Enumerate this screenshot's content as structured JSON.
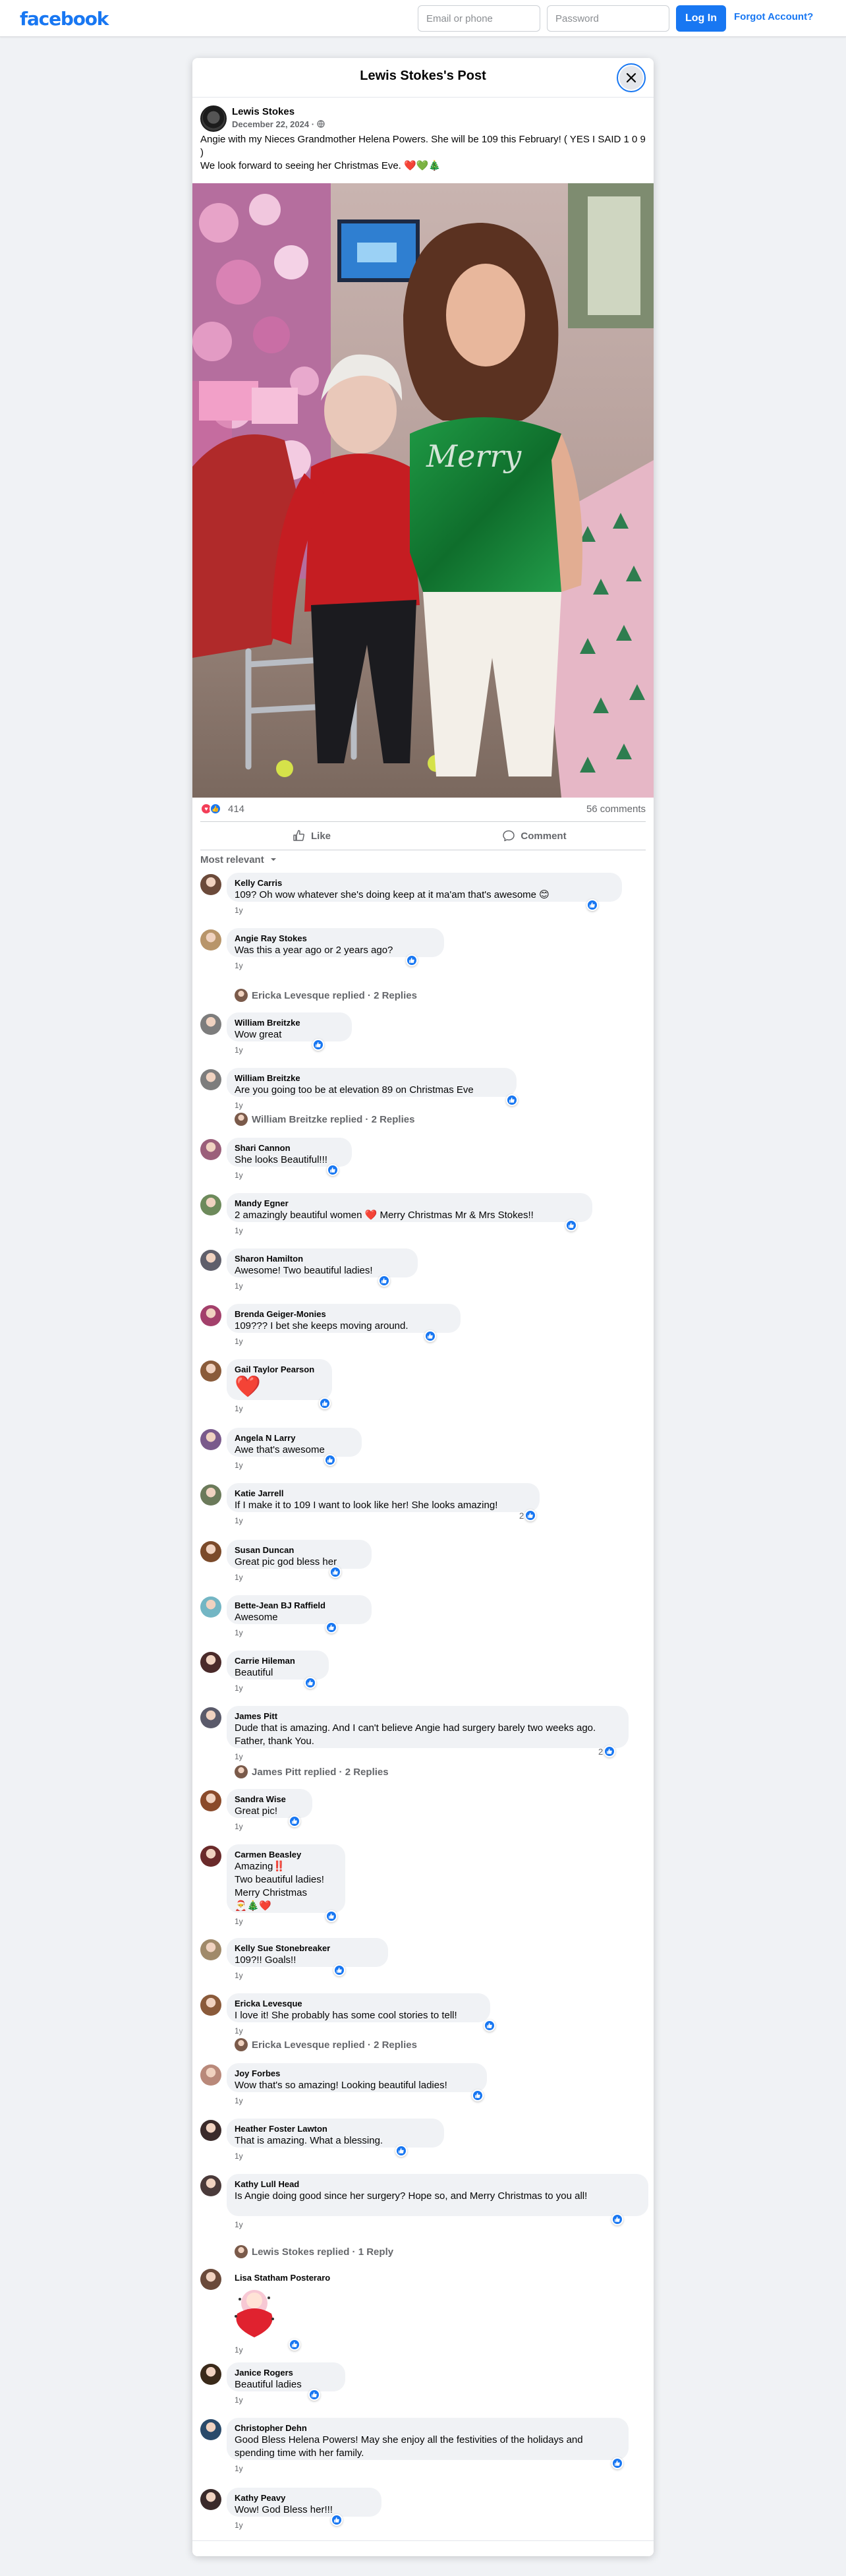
{
  "topbar": {
    "logo": "facebook",
    "email_placeholder": "Email or phone",
    "password_placeholder": "Password",
    "login_label": "Log In",
    "forgot_label": "Forgot Account?"
  },
  "post": {
    "header_title": "Lewis Stokes's Post",
    "author": "Lewis Stokes",
    "date": "December 22, 2024 · ",
    "privacy_icon": "globe-icon",
    "text_line1": "Angie with my Nieces Grandmother Helena Powers. She will be 109 this February! ( YES I SAID 1 0 9  )",
    "text_line2": "We look forward to seeing her Christmas Eve. ❤️💚🎄",
    "photo_shirt_text": "Merry",
    "reaction_count": "414",
    "comment_count": "56 comments",
    "like_label": "Like",
    "comment_label": "Comment",
    "sort_label": "Most relevant"
  },
  "comments": [
    {
      "name": "Kelly Carris",
      "text": "109? Oh wow whatever she's doing keep at it ma'am that's awesome 😊",
      "time": "1y",
      "likes": ""
    },
    {
      "name": "Angie Ray Stokes",
      "text": "Was this a year ago or 2 years ago?",
      "time": "1y",
      "likes": "",
      "replies": "Ericka Levesque replied · 2 Replies"
    },
    {
      "name": "William Breitzke",
      "text": "Wow great",
      "time": "1y",
      "likes": ""
    },
    {
      "name": "William Breitzke",
      "text": "Are you going too be at elevation 89 on Christmas Eve",
      "time": "1y",
      "likes": "",
      "replies": "William Breitzke replied · 2 Replies"
    },
    {
      "name": "Shari Cannon",
      "text": "She looks Beautiful!!!",
      "time": "1y",
      "likes": ""
    },
    {
      "name": "Mandy Egner",
      "text": "2 amazingly beautiful women ❤️ Merry Christmas Mr & Mrs Stokes!!",
      "time": "1y",
      "likes": ""
    },
    {
      "name": "Sharon Hamilton",
      "text": "Awesome! Two beautiful ladies!",
      "time": "1y",
      "likes": ""
    },
    {
      "name": "Brenda Geiger-Monies",
      "text": "109??? I bet she keeps moving around.",
      "time": "1y",
      "likes": ""
    },
    {
      "name": "Gail Taylor Pearson",
      "text": "❤️",
      "time": "1y",
      "likes": ""
    },
    {
      "name": "Angela N Larry",
      "text": "Awe that's awesome",
      "time": "1y",
      "likes": ""
    },
    {
      "name": "Katie Jarrell",
      "text": "If I make it to 109 I want to look like her! She looks amazing!",
      "time": "1y",
      "likes": "2"
    },
    {
      "name": "Susan Duncan",
      "text": "Great pic god bless her",
      "time": "1y",
      "likes": ""
    },
    {
      "name": "Bette-Jean BJ Raffield",
      "text": "Awesome",
      "time": "1y",
      "likes": ""
    },
    {
      "name": "Carrie Hileman",
      "text": "Beautiful",
      "time": "1y",
      "likes": ""
    },
    {
      "name": "James Pitt",
      "text": "Dude that is amazing. And I can't believe Angie had surgery barely two weeks ago. Father, thank You.",
      "time": "1y",
      "likes": "2",
      "replies": "James Pitt replied · 2 Replies"
    },
    {
      "name": "Sandra Wise",
      "text": "Great pic!",
      "time": "1y",
      "likes": ""
    },
    {
      "name": "Carmen Beasley",
      "lines": [
        "Amazing‼️",
        "Two beautiful ladies!",
        "Merry Christmas",
        "🎅🎄❤️"
      ],
      "time": "1y",
      "likes": ""
    },
    {
      "name": "Kelly Sue Stonebreaker",
      "text": "109?!! Goals!!",
      "time": "1y",
      "likes": ""
    },
    {
      "name": "Ericka Levesque",
      "text": "I love it! She probably has some cool stories to tell!",
      "time": "1y",
      "likes": "",
      "replies": "Ericka Levesque replied · 2 Replies"
    },
    {
      "name": "Joy Forbes",
      "text": "Wow that's so amazing! Looking beautiful ladies!",
      "time": "1y",
      "likes": ""
    },
    {
      "name": "Heather Foster Lawton",
      "text": "That is amazing. What a blessing.",
      "time": "1y",
      "likes": ""
    },
    {
      "name": "Kathy Lull Head",
      "text": "Is Angie doing good since her surgery? Hope so, and Merry Christmas to you all!",
      "time": "1y",
      "likes": "",
      "replies": "Lewis Stokes replied · 1 Reply"
    },
    {
      "name": "Lisa Statham Posteraro",
      "text": "",
      "time": "1y",
      "likes": ""
    },
    {
      "name": "Janice Rogers",
      "text": "Beautiful ladies",
      "time": "1y",
      "likes": ""
    },
    {
      "name": "Christopher Dehn",
      "text": "Good Bless Helena Powers! May she enjoy all the festivities of the holidays and spending time with her family.",
      "time": "1y",
      "likes": ""
    },
    {
      "name": "Kathy Peavy",
      "text": "Wow! God Bless her!!!",
      "time": "1y",
      "likes": ""
    }
  ],
  "colors": {
    "brand": "#1877f2",
    "bubble": "#f0f2f5",
    "muted": "#65676b"
  }
}
